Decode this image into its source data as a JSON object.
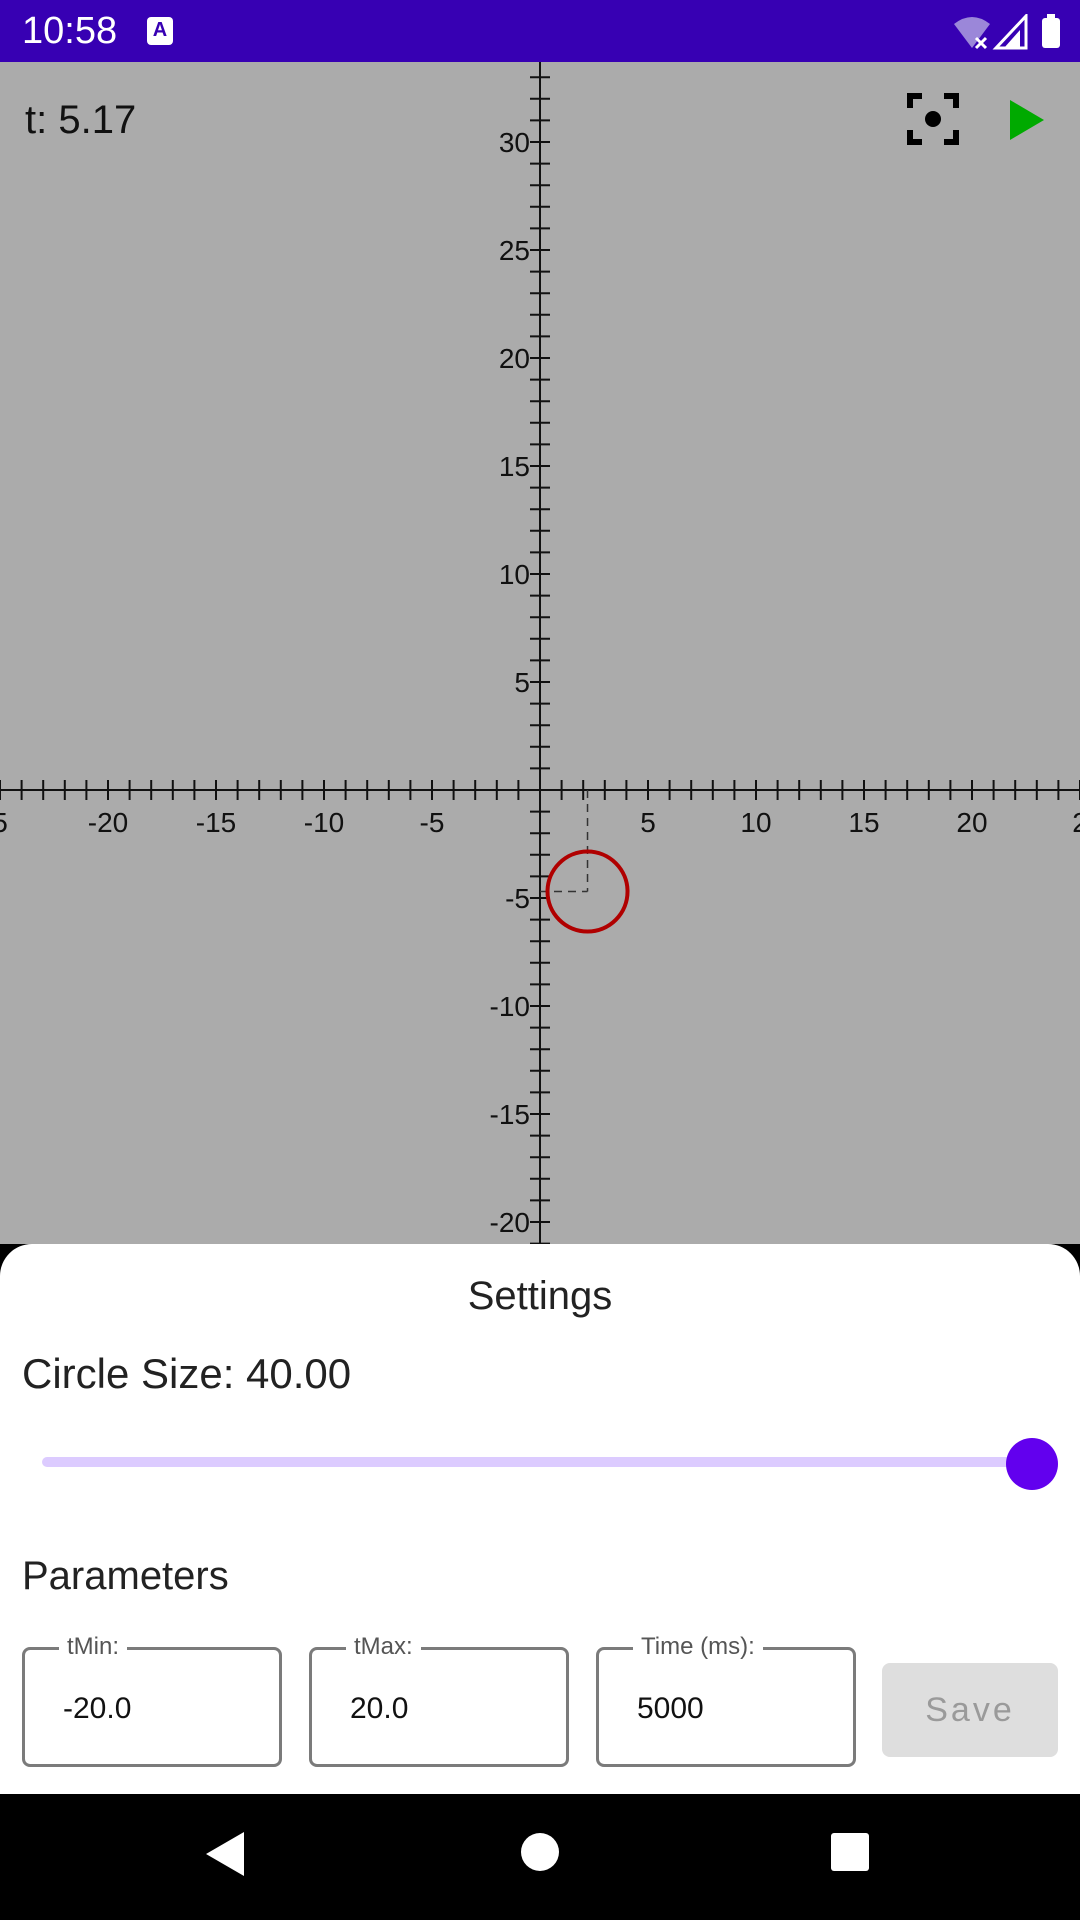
{
  "status_bar": {
    "time": "10:58",
    "a_icon_text": "A",
    "bg_color": "#3700b3"
  },
  "graph": {
    "t_label": "t: 5.17",
    "background_color": "#ababab",
    "x_tick_labels": [
      "5",
      "-20",
      "-15",
      "-10",
      "-5",
      "5",
      "10",
      "15",
      "20",
      "2"
    ],
    "y_tick_labels": [
      "30",
      "25",
      "20",
      "15",
      "10",
      "5",
      "-5",
      "-10",
      "-15",
      "-20"
    ],
    "circle": {
      "x": 2.2,
      "y": -4.7,
      "color": "#b00000"
    },
    "play_icon_color": "#00aa00"
  },
  "settings": {
    "title": "Settings",
    "circle_size_label": "Circle Size: 40.00",
    "slider_value": 1.0,
    "slider_color": "#6200ee",
    "parameters_label": "Parameters",
    "fields": [
      {
        "label": "tMin:",
        "value": "-20.0"
      },
      {
        "label": "tMax:",
        "value": "20.0"
      },
      {
        "label": "Time (ms):",
        "value": "5000"
      }
    ],
    "save_label": "Save"
  }
}
